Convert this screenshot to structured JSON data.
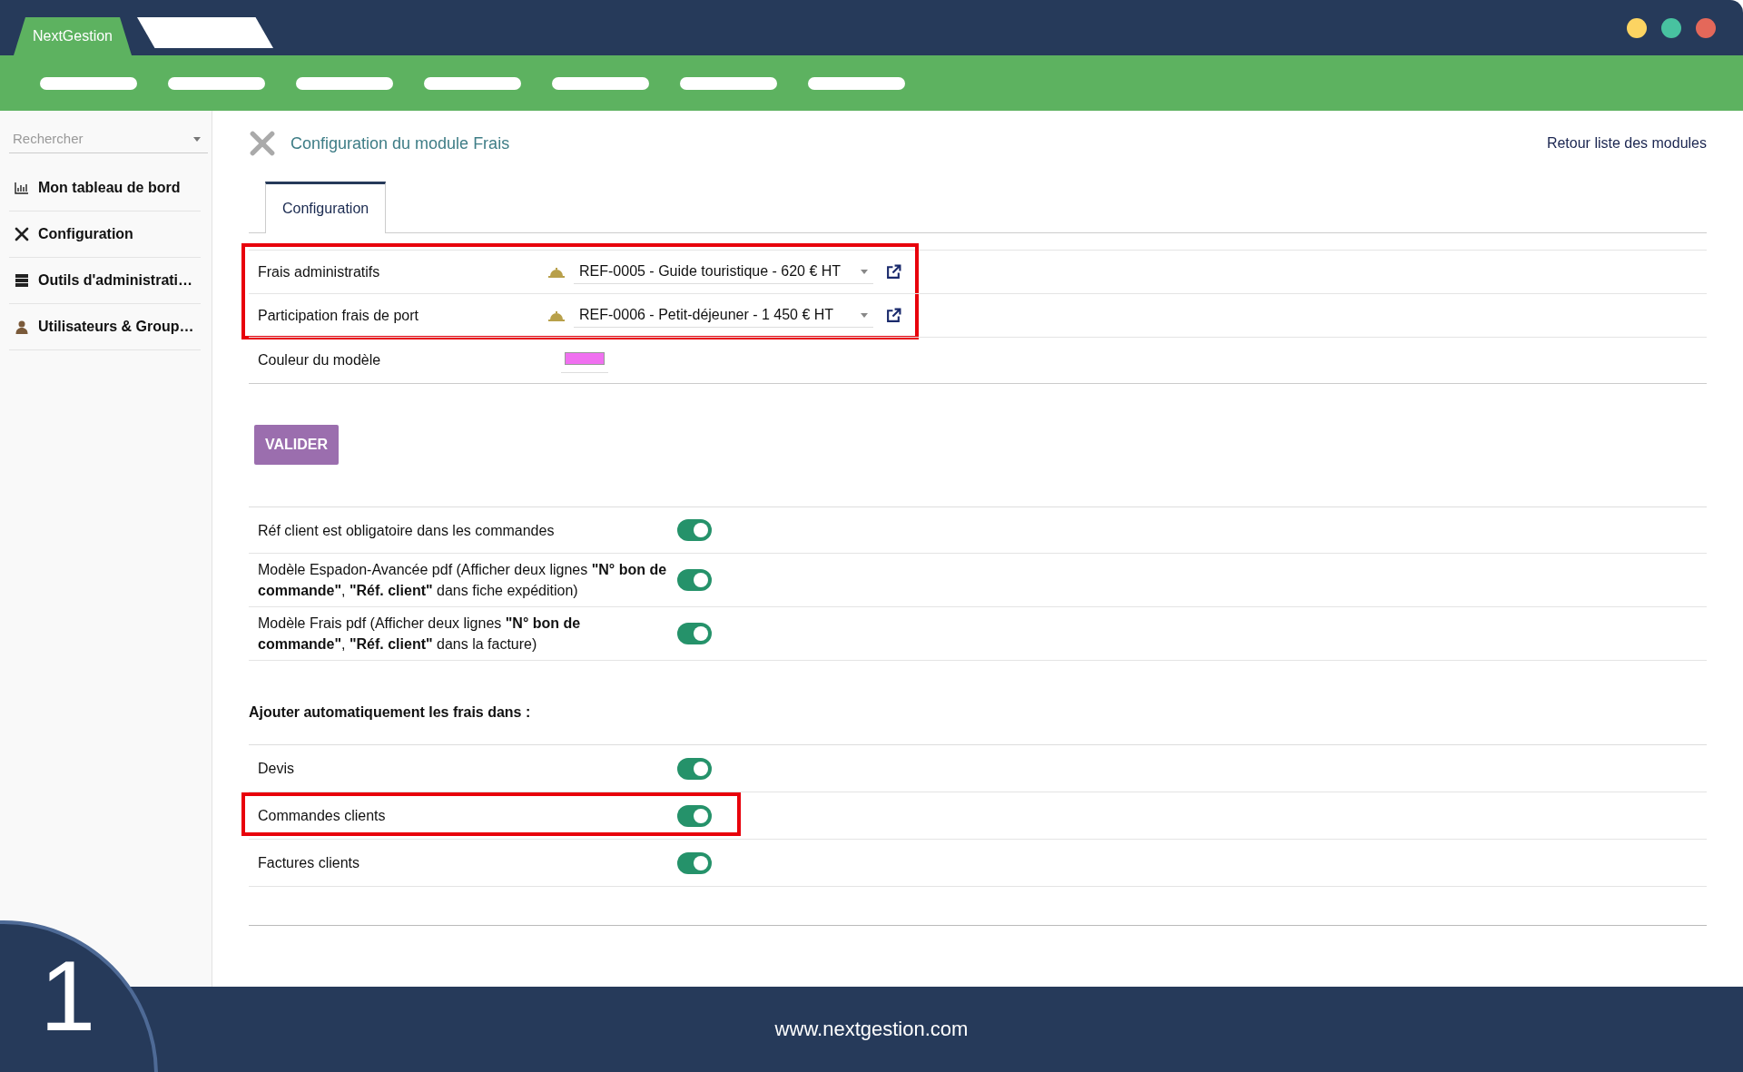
{
  "app_tabs": [
    {
      "label": "NextGestion",
      "selected": true
    },
    {
      "selected": false
    }
  ],
  "window_controls": [
    {
      "color": "#fcd462"
    },
    {
      "color": "#48c2a0"
    },
    {
      "color": "#e4685a"
    }
  ],
  "sidebar": {
    "search": {
      "placeholder": "Rechercher"
    },
    "items": [
      {
        "label": "Mon tableau de bord",
        "kind": "chart"
      },
      {
        "label": "Configuration",
        "kind": "tools"
      },
      {
        "label": "Outils d'administrati…",
        "kind": "server"
      },
      {
        "label": "Utilisateurs & Group…",
        "kind": "user"
      }
    ]
  },
  "page": {
    "title": "Configuration du module Frais",
    "back_link": "Retour liste des modules"
  },
  "tabs": [
    {
      "label": "Configuration",
      "selected": true
    }
  ],
  "product_fields": [
    {
      "label": "Frais administratifs",
      "value": "REF-0005 - Guide touristique - 620 € HT"
    },
    {
      "label": "Participation frais de port",
      "value": "REF-0006 - Petit-déjeuner - 1 450 € HT"
    }
  ],
  "color_field": {
    "label": "Couleur du modèle",
    "color": "#f070f0"
  },
  "submit_button": "VALIDER",
  "options": [
    {
      "label": "Réf client est obligatoire dans les commandes",
      "on": true
    },
    {
      "label": "Modèle Espadon-Avancée pdf (Afficher deux lignes **\"N° bon de commande\"**, **\"Réf. client\"** dans fiche expédition)",
      "on": true
    },
    {
      "label": "Modèle Frais pdf (Afficher deux lignes **\"N° bon de commande\"**, **\"Réf. client\"** dans la facture)",
      "on": true
    }
  ],
  "auto_section": {
    "heading": "Ajouter automatiquement les frais dans :",
    "items": [
      {
        "label": "Devis",
        "on": true,
        "highlighted": false
      },
      {
        "label": "Commandes clients",
        "on": true,
        "highlighted": true
      },
      {
        "label": "Factures clients",
        "on": true,
        "highlighted": false
      }
    ]
  },
  "step_number": "1",
  "footer": "www.nextgestion.com"
}
